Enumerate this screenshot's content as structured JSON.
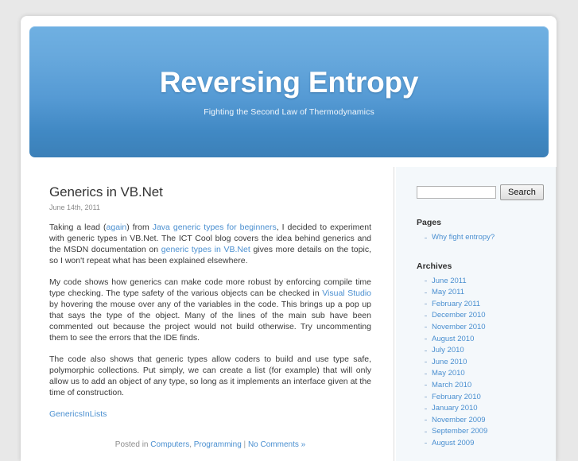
{
  "site": {
    "title": "Reversing Entropy",
    "tagline": "Fighting the Second Law of Thermodynamics"
  },
  "post": {
    "title": "Generics in VB.Net",
    "date": "June 14th, 2011",
    "paragraphs": {
      "p1_a": "Taking a lead (",
      "p1_link1": "again",
      "p1_b": ") from ",
      "p1_link2": "Java generic types for beginners",
      "p1_c": ", I decided to experiment with generic types in VB.Net. The ICT Cool blog covers the idea behind generics and the MSDN documentation on ",
      "p1_link3": "generic types in VB.Net",
      "p1_d": " gives more details on the topic, so I won't repeat what has been explained elsewhere.",
      "p2_a": "My code shows how generics can make code more robust by enforcing compile time type checking. The type safety of the various objects can be checked in ",
      "p2_link1": "Visual Studio",
      "p2_b": " by hovering the mouse over any of the variables in the code. This brings up a pop up that says the type of the object. Many of the lines of the main sub have been commented out because the project would not build otherwise. Try uncommenting them to see the errors that the IDE finds.",
      "p3": "The code also shows that generic types allow coders to build and use type safe, polymorphic collections. Put simply, we can create a list (for example) that will only allow us to add an object of any type, so long as it implements an interface given at the time of construction."
    },
    "attachment_label": "GenericsInLists",
    "meta": {
      "posted_in_label": "Posted in ",
      "category1": "Computers",
      "category_separator": ", ",
      "category2": "Programming",
      "divider": " | ",
      "comments_label": "No Comments »"
    }
  },
  "sidebar": {
    "search": {
      "value": "",
      "placeholder": "",
      "button_label": "Search"
    },
    "pages": {
      "title": "Pages",
      "items": [
        {
          "label": "Why fight entropy?"
        }
      ]
    },
    "archives": {
      "title": "Archives",
      "items": [
        {
          "label": "June 2011"
        },
        {
          "label": "May 2011"
        },
        {
          "label": "February 2011"
        },
        {
          "label": "December 2010"
        },
        {
          "label": "November 2010"
        },
        {
          "label": "August 2010"
        },
        {
          "label": "July 2010"
        },
        {
          "label": "June 2010"
        },
        {
          "label": "May 2010"
        },
        {
          "label": "March 2010"
        },
        {
          "label": "February 2010"
        },
        {
          "label": "January 2010"
        },
        {
          "label": "November 2009"
        },
        {
          "label": "September 2009"
        },
        {
          "label": "August 2009"
        }
      ]
    }
  },
  "colors": {
    "link": "#4a8fd0",
    "banner_top": "#6fb0e2",
    "banner_bottom": "#3b80b8",
    "page_background": "#e8e8e8",
    "sidebar_background": "#f4f8fb"
  }
}
